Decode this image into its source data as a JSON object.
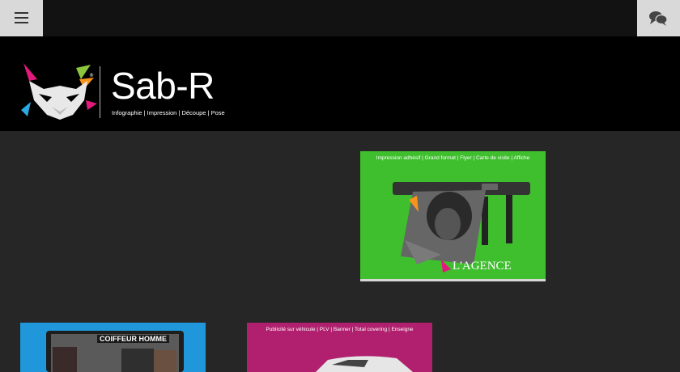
{
  "brand": {
    "name": "Sab-R",
    "registered": "®",
    "tagline": "Infographie | Impression | Découpe | Pose"
  },
  "topbar": {
    "menu_icon": "hamburger-menu-icon",
    "chat_icon": "chat-bubbles-icon"
  },
  "cards": [
    {
      "caption": "Impression adhésif | Grand format | Flyer | Carte de visite | Affiche",
      "title": "L'AGENCE",
      "accent": "#3fbf2e"
    },
    {
      "caption": "Publicité sur véhicule | PLV | Banner | Total covering | Enseigne",
      "accent": "#b0206e"
    },
    {
      "caption": "COIFFEUR HOMME",
      "accent": "#1f97da"
    }
  ],
  "colors": {
    "page_bg": "#262626",
    "topbar_bg": "#121212",
    "header_bg": "#000000",
    "button_bg": "#d9d9d9"
  }
}
